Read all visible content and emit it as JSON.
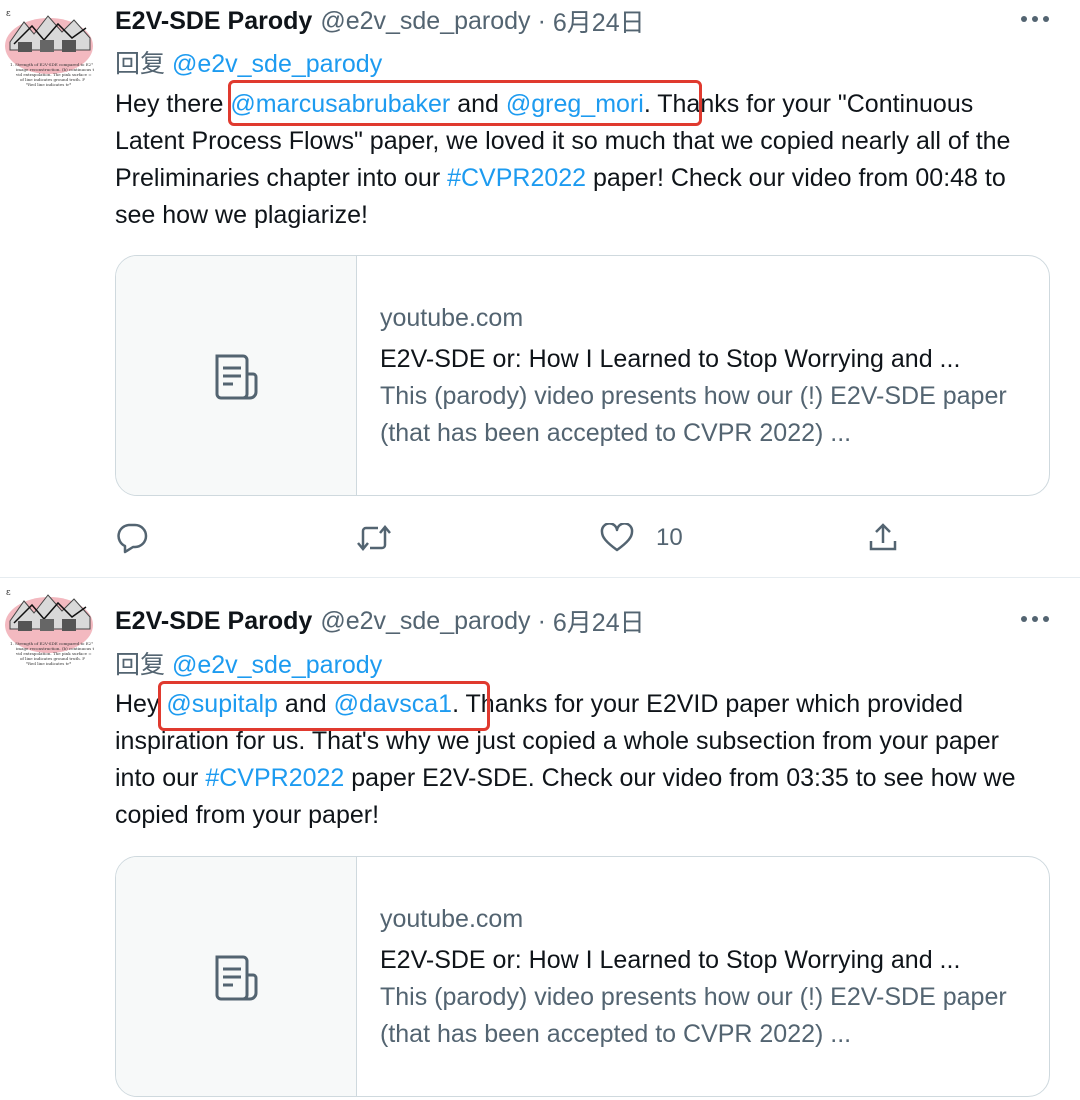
{
  "tweets": [
    {
      "author": {
        "name": "E2V-SDE Parody",
        "handle": "@e2v_sde_parody",
        "separator": "·",
        "date": "6月24日",
        "avatar_caption": "ε  1. Strength of E2V-SDE compared to E2° image reconstruction. (b) continuous time vid extrapolation. The pink surface = of line indicates ground truth. F *Red line indicates tr*"
      },
      "more_icon": "more-horizontal-icon",
      "reply_label": "回复",
      "reply_handle": "@e2v_sde_parody",
      "text": {
        "pre": "Hey there ",
        "mention1": "@marcusabrubaker",
        "mid": " and ",
        "mention2": "@greg_mori",
        "post1": ". Thanks for your \"Continuous Latent Process Flows\" paper, we loved it so much that we copied nearly all of the Preliminaries chapter into our ",
        "hashtag": "#CVPR2022",
        "post2": " paper! Check our video from 00:48 to see how we plagiarize!"
      },
      "card": {
        "icon": "document-icon",
        "domain": "youtube.com",
        "title": "E2V-SDE or: How I Learned to Stop Worrying and ...",
        "description": "This (parody) video presents how our (!) E2V-SDE paper (that has been accepted to CVPR 2022) ..."
      },
      "actions": {
        "reply_icon": "reply-icon",
        "retweet_icon": "retweet-icon",
        "like_icon": "like-icon",
        "like_count": "10",
        "share_icon": "share-icon"
      }
    },
    {
      "author": {
        "name": "E2V-SDE Parody",
        "handle": "@e2v_sde_parody",
        "separator": "·",
        "date": "6月24日",
        "avatar_caption": "ε  1. Strength of E2V-SDE compared to E2° image reconstruction. (b) continuous time vid extrapolation. The pink surface = of line indicates ground truth. F *Red line indicates tr*"
      },
      "more_icon": "more-horizontal-icon",
      "reply_label": "回复",
      "reply_handle": "@e2v_sde_parody",
      "text": {
        "pre": "Hey ",
        "mention1": "@supitalp",
        "mid": " and ",
        "mention2": "@davsca1",
        "post1": ". Thanks for your E2VID paper which provided inspiration for us. That's why we just copied a whole subsection from your paper into our ",
        "hashtag": "#CVPR2022",
        "post2": " paper E2V-SDE. Check our video from 03:35 to see how we copied from your paper!"
      },
      "card": {
        "icon": "document-icon",
        "domain": "youtube.com",
        "title": "E2V-SDE or: How I Learned to Stop Worrying and ...",
        "description": "This (parody) video presents how our (!) E2V-SDE paper (that has been accepted to CVPR 2022) ..."
      }
    }
  ],
  "colors": {
    "link": "#1d9bf0",
    "secondary_text": "#536471",
    "highlight_box": "#e03a2f",
    "border": "#cfd9de"
  }
}
